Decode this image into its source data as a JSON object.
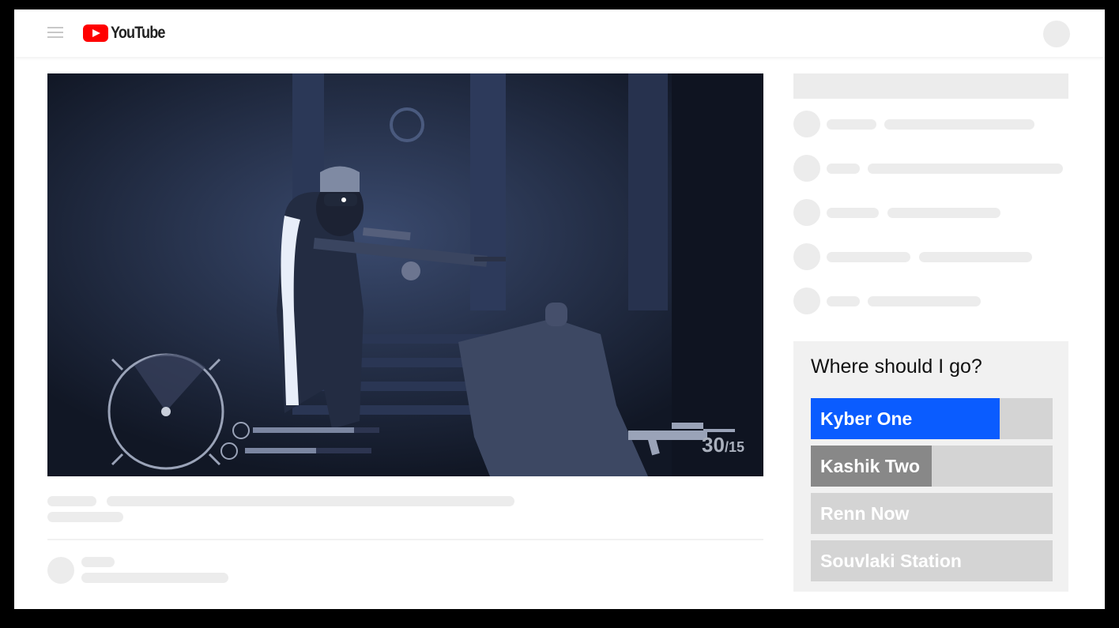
{
  "header": {
    "logo_text": "YouTube",
    "menu_icon": "hamburger-menu-icon",
    "logo_icon": "youtube-play-icon"
  },
  "video": {
    "ammo_current": "30",
    "ammo_total": "/15"
  },
  "poll": {
    "question": "Where should I go?",
    "options": [
      {
        "label": "Kyber One",
        "share": 0.78,
        "color": "#0a5cff"
      },
      {
        "label": "Kashik Two",
        "share": 0.5,
        "color": "#888888"
      },
      {
        "label": "Renn Now",
        "share": 0,
        "color": "#d4d4d4"
      },
      {
        "label": "Souvlaki Station",
        "share": 0,
        "color": "#d4d4d4"
      }
    ]
  }
}
